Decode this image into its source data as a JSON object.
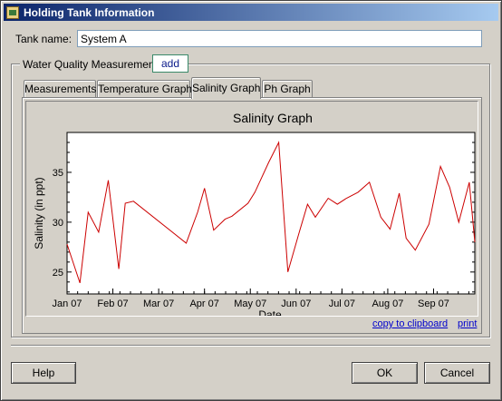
{
  "window": {
    "title": "Holding Tank Information",
    "icon": "app-icon"
  },
  "tank": {
    "label": "Tank name:",
    "value": "System A"
  },
  "group": {
    "label": "Water Quality Measurements",
    "add_label": "add"
  },
  "tabs": [
    {
      "label": "Measurements",
      "active": false
    },
    {
      "label": "Temperature Graph",
      "active": false
    },
    {
      "label": "Salinity Graph",
      "active": true
    },
    {
      "label": "Ph Graph",
      "active": false
    }
  ],
  "chart_data": {
    "type": "line",
    "title": "Salinity Graph",
    "xlabel": "Date",
    "ylabel": "Salinity (in ppt)",
    "x_tick_labels": [
      "Jan 07",
      "Feb 07",
      "Mar 07",
      "Apr 07",
      "May 07",
      "Jun 07",
      "Jul 07",
      "Aug 07",
      "Sep 07"
    ],
    "y_tick_labels": [
      "25",
      "30",
      "35"
    ],
    "ylim": [
      22.8,
      39.0
    ],
    "xlim_months": [
      0,
      8.9
    ],
    "series": [
      {
        "color": "#cc0000",
        "x": [
          0.0,
          0.28,
          0.46,
          0.69,
          0.9,
          1.13,
          1.27,
          1.45,
          2.6,
          2.85,
          3.0,
          3.2,
          3.45,
          3.6,
          3.95,
          4.1,
          4.4,
          4.62,
          4.82,
          5.05,
          5.25,
          5.42,
          5.7,
          5.9,
          6.1,
          6.35,
          6.6,
          6.85,
          7.05,
          7.25,
          7.4,
          7.6,
          7.9,
          8.15,
          8.35,
          8.55,
          8.78,
          8.9
        ],
        "y": [
          27.8,
          23.9,
          31.0,
          29.0,
          34.2,
          25.3,
          31.9,
          32.1,
          27.9,
          31.0,
          33.4,
          29.2,
          30.3,
          30.6,
          31.9,
          33.0,
          36.0,
          38.0,
          25.0,
          28.7,
          31.8,
          30.5,
          32.4,
          31.8,
          32.4,
          33.0,
          34.0,
          30.5,
          29.3,
          32.9,
          28.4,
          27.2,
          29.8,
          35.6,
          33.5,
          30.0,
          34.0,
          28.0
        ]
      }
    ]
  },
  "graph_links": {
    "copy": "copy to clipboard",
    "print": "print"
  },
  "buttons": {
    "help": "Help",
    "ok": "OK",
    "cancel": "Cancel"
  }
}
